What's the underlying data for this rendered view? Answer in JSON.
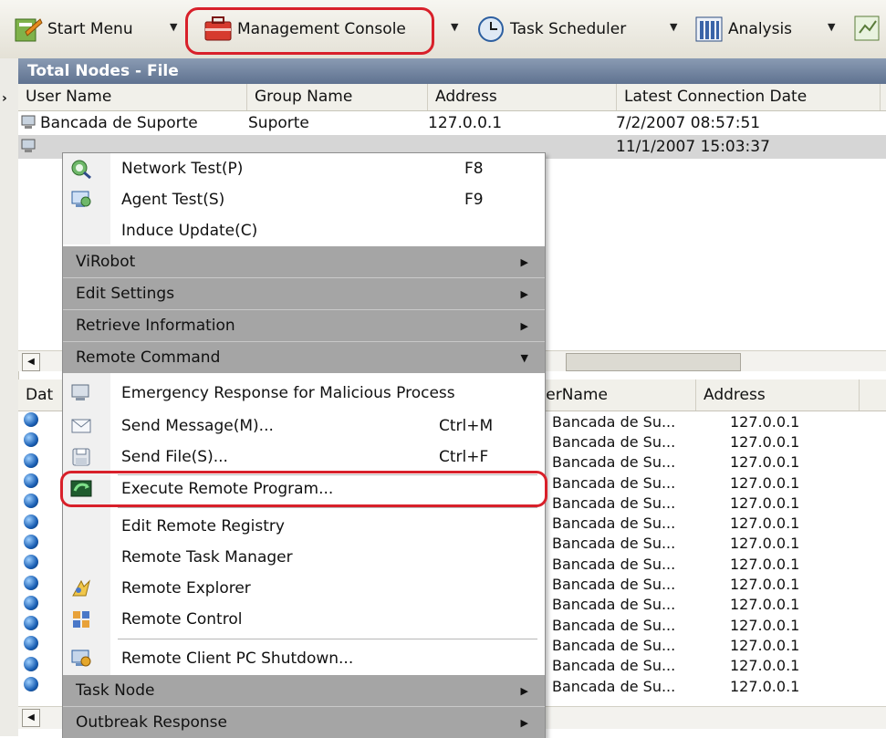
{
  "toolbar": {
    "start_menu": "Start Menu",
    "management_console": "Management Console",
    "task_scheduler": "Task Scheduler",
    "analysis": "Analysis",
    "dropdown_arrow": "▼"
  },
  "top_grid": {
    "title": "Total Nodes - File",
    "columns": [
      "User Name",
      "Group Name",
      "Address",
      "Latest Connection Date"
    ],
    "rows": [
      {
        "user": "Bancada de Suporte",
        "group": "Suporte",
        "address": "127.0.0.1",
        "date": "7/2/2007 08:57:51"
      },
      {
        "user": "",
        "group": "",
        "address": "",
        "date": "11/1/2007 15:03:37"
      }
    ]
  },
  "bottom_grid": {
    "columns": [
      "Dat",
      "UserName",
      "Address"
    ],
    "rows": [
      {
        "user": "Bancada de Su...",
        "address": "127.0.0.1"
      },
      {
        "user": "Bancada de Su...",
        "address": "127.0.0.1"
      },
      {
        "user": "Bancada de Su...",
        "address": "127.0.0.1"
      },
      {
        "user": "Bancada de Su...",
        "address": "127.0.0.1"
      },
      {
        "user": "Bancada de Su...",
        "address": "127.0.0.1"
      },
      {
        "user": "Bancada de Su...",
        "address": "127.0.0.1"
      },
      {
        "user": "Bancada de Su...",
        "address": "127.0.0.1"
      },
      {
        "user": "Bancada de Su...",
        "address": "127.0.0.1"
      },
      {
        "user": "Bancada de Su...",
        "address": "127.0.0.1"
      },
      {
        "user": "Bancada de Su...",
        "address": "127.0.0.1"
      },
      {
        "user": "Bancada de Su...",
        "address": "127.0.0.1"
      },
      {
        "user": "Bancada de Su...",
        "address": "127.0.0.1"
      },
      {
        "user": "Bancada de Su...",
        "address": "127.0.0.1"
      },
      {
        "user": "Bancada de Su...",
        "address": "127.0.0.1"
      }
    ]
  },
  "context_menu": {
    "network_test": "Network Test(P)",
    "network_test_shortcut": "F8",
    "agent_test": "Agent Test(S)",
    "agent_test_shortcut": "F9",
    "induce_update": "Induce Update(C)",
    "virobot": "ViRobot",
    "edit_settings": "Edit Settings",
    "retrieve_information": "Retrieve Information",
    "remote_command": "Remote Command",
    "emergency_response": "Emergency Response for Malicious Process",
    "send_message": "Send Message(M)...",
    "send_message_shortcut": "Ctrl+M",
    "send_file": "Send File(S)...",
    "send_file_shortcut": "Ctrl+F",
    "execute_remote_program": "Execute Remote Program...",
    "edit_remote_registry": "Edit Remote Registry",
    "remote_task_manager": "Remote Task Manager",
    "remote_explorer": "Remote Explorer",
    "remote_control": "Remote Control",
    "remote_shutdown": "Remote Client PC Shutdown...",
    "task_node": "Task Node",
    "outbreak_response": "Outbreak Response",
    "submenu_arrow": "▶",
    "expanded_arrow": "▼"
  },
  "colors": {
    "highlight": "#d8202a",
    "submenu_bg": "#a5a5a5",
    "title_bar": "#5f7290"
  }
}
